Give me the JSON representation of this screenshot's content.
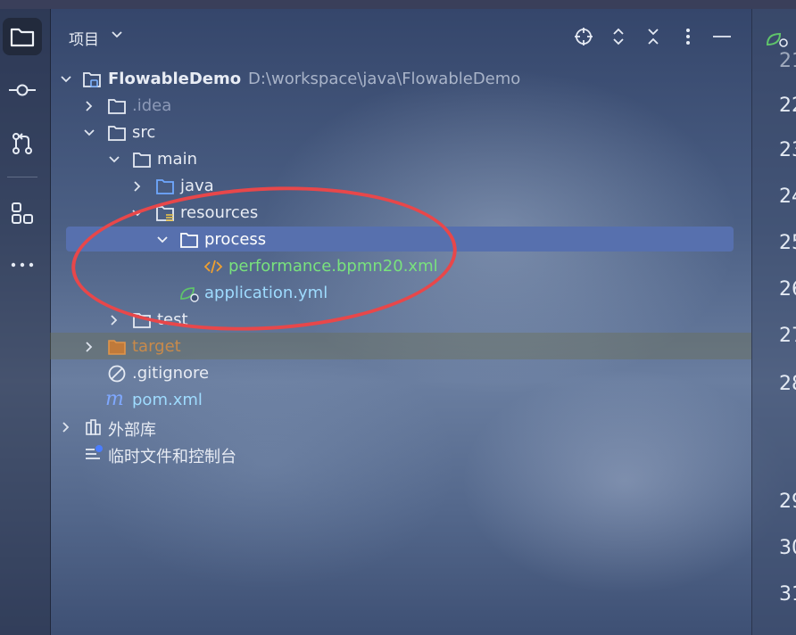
{
  "header": {
    "title": "项目"
  },
  "tree": {
    "root_name": "FlowableDemo",
    "root_path": "D:\\workspace\\java\\FlowableDemo",
    "idea": ".idea",
    "src": "src",
    "main": "main",
    "java": "java",
    "resources": "resources",
    "process": "process",
    "bpmn_file": "performance.bpmn20.xml",
    "application": "application.yml",
    "test": "test",
    "target": "target",
    "gitignore": ".gitignore",
    "pom": "pom.xml",
    "external_libs": "外部库",
    "scratches": "临时文件和控制台"
  },
  "gutter": {
    "lines": [
      "21",
      "22",
      "23",
      "24",
      "25",
      "26",
      "27",
      "28",
      "29",
      "30",
      "31"
    ]
  },
  "colors": {
    "selection": "#5770ae",
    "annotation": "#e8474a"
  }
}
